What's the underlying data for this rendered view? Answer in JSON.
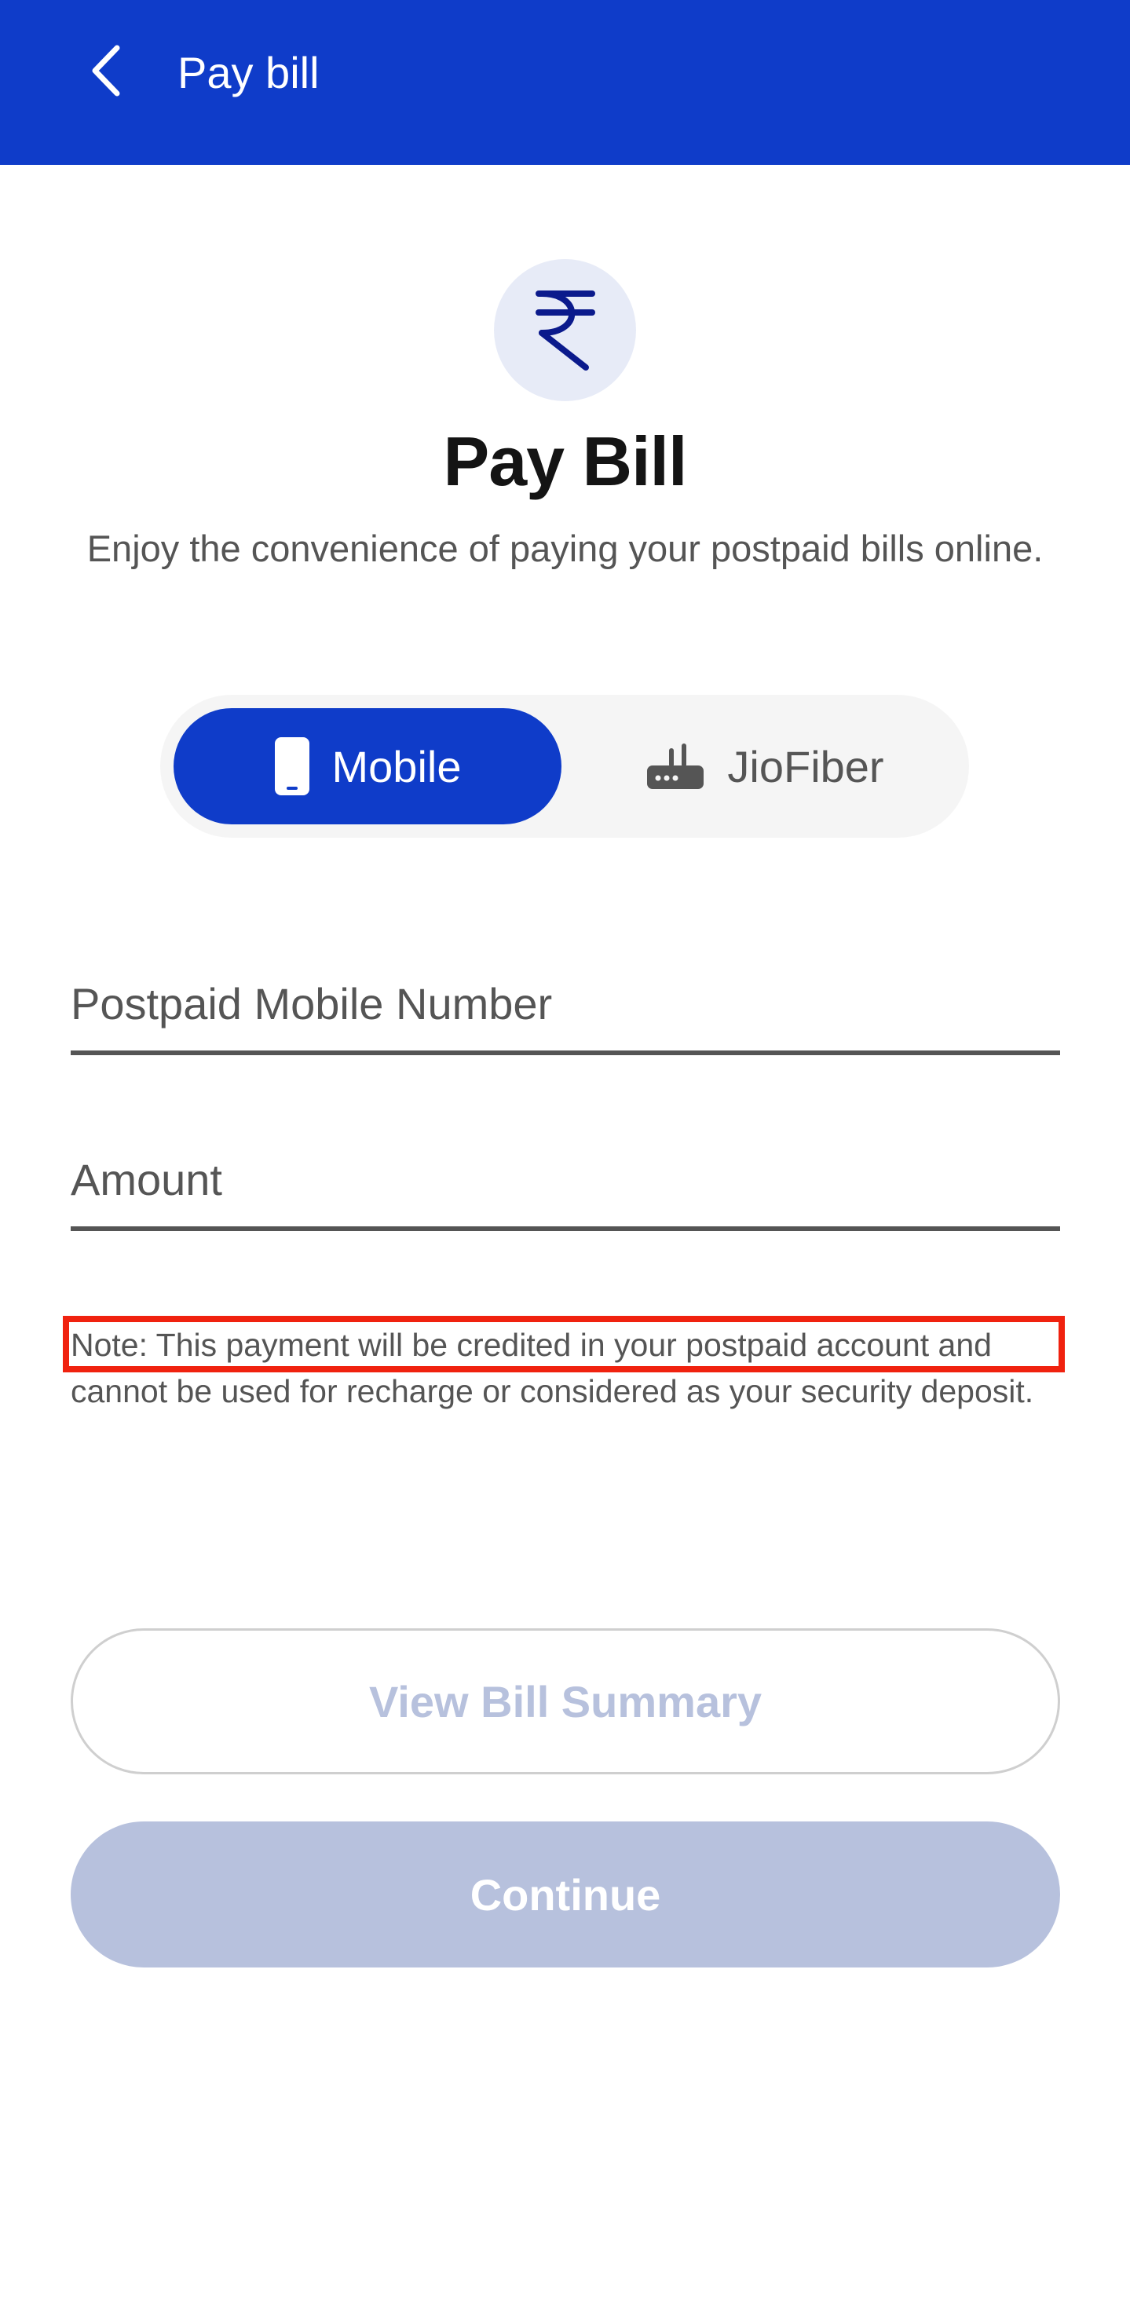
{
  "header": {
    "title": "Pay bill",
    "back_icon": "chevron-left-icon",
    "background_color": "#0f3cc9"
  },
  "hero": {
    "icon": "rupee-icon",
    "icon_glyph": "₹",
    "title": "Pay Bill",
    "subtitle": "Enjoy the convenience of paying your postpaid bills online."
  },
  "toggle": {
    "selected": "Mobile",
    "options": [
      {
        "label": "Mobile",
        "icon": "phone-icon"
      },
      {
        "label": "JioFiber",
        "icon": "router-icon"
      }
    ]
  },
  "form": {
    "mobile_placeholder": "Postpaid Mobile Number",
    "amount_placeholder": "Amount"
  },
  "note": "Note: This payment will be credited in your postpaid account and cannot be used for recharge or considered as your security deposit.",
  "buttons": {
    "view_summary": "View Bill Summary",
    "continue": "Continue"
  },
  "colors": {
    "primary": "#0f3cc9",
    "disabled": "#b7c1dd",
    "highlight": "#f0220f"
  }
}
